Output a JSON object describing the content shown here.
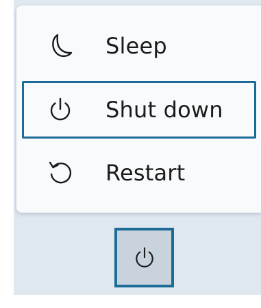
{
  "power_menu": {
    "items": [
      {
        "label": "Sleep",
        "icon": "moon-icon"
      },
      {
        "label": "Shut down",
        "icon": "power-icon",
        "focused": true
      },
      {
        "label": "Restart",
        "icon": "restart-icon"
      }
    ]
  },
  "taskbar": {
    "power_button_icon": "power-icon",
    "focused": true
  },
  "colors": {
    "focus_ring": "#1c6c97",
    "menu_background": "#f8fafc",
    "text": "#1b1b1b",
    "backdrop": "#dfe7ef"
  }
}
